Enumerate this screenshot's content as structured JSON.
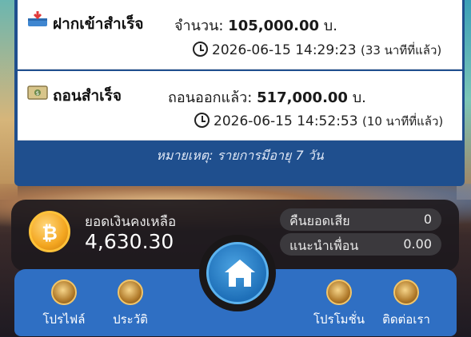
{
  "transactions": [
    {
      "title": "ฝากเข้าสำเร็จ",
      "amount_label": "จำนวน:",
      "amount_value": "105,000.00",
      "amount_unit": "บ.",
      "time": "2026-06-15 14:29:23",
      "ago": "(33 นาทีที่แล้ว)",
      "icon": "deposit-icon"
    },
    {
      "title": "ถอนสำเร็จ",
      "amount_label": "ถอนออกแล้ว:",
      "amount_value": "517,000.00",
      "amount_unit": "บ.",
      "time": "2026-06-15 14:52:53",
      "ago": "(10 นาทีที่แล้ว)",
      "icon": "withdraw-icon"
    }
  ],
  "note": "หมายเหตุ: รายการมีอายุ 7 วัน",
  "wallet": {
    "balance_label": "ยอดเงินคงเหลือ",
    "balance_value": "4,630.30",
    "coin_symbol": "₿",
    "cashback_label": "คืนยอดเสีย",
    "cashback_value": "0",
    "referral_label": "แนะนำเพื่อน",
    "referral_value": "0.00"
  },
  "nav": {
    "profile": "โปรไฟล์",
    "history": "ประวัติ",
    "promotion": "โปรโมชั่น",
    "contact": "ติดต่อเรา"
  },
  "colors": {
    "panel_blue": "#1f4f8e",
    "nav_blue": "#2f6fc3",
    "coin_gold": "#f3a620"
  }
}
